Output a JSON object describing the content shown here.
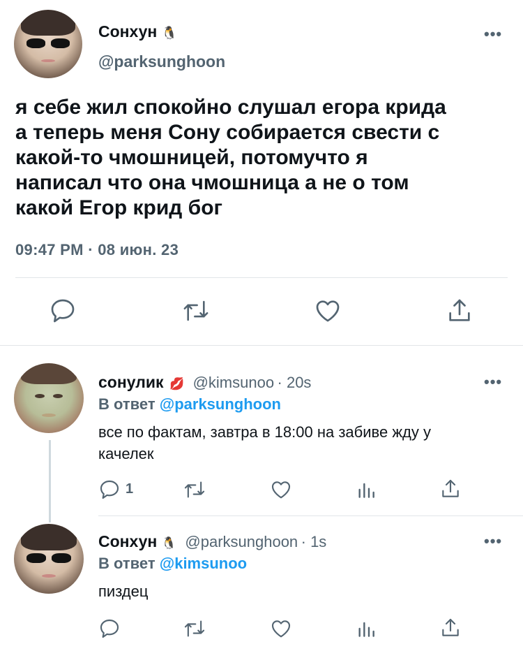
{
  "main_tweet": {
    "display_name": "Сонхун",
    "name_emoji": "🐧",
    "handle": "@parksunghoon",
    "text_lines": [
      "я себе жил спокойно слушал егора крида",
      "а теперь меня Сону собирается свести с",
      "какой-то чмошницей, потомучто я",
      "написал что она чмошница а не о том",
      "какой Егор крид бог"
    ],
    "timestamp": "09:47 PM · 08 июн. 23",
    "more": "•••",
    "actions": [
      "reply-icon",
      "retweet-icon",
      "like-icon",
      "share-icon"
    ]
  },
  "reply1": {
    "display_name": "сонулик",
    "name_emoji": "💋",
    "handle": "@kimsunoo",
    "time": "· 20s",
    "reply_to_prefix": "В ответ",
    "reply_to_mention": "@parksunghoon",
    "text_lines": [
      "все по фактам, завтра в 18:00 на забиве жду у",
      "качелек"
    ],
    "reply_count": "1",
    "more": "•••"
  },
  "reply2": {
    "display_name": "Сонхун",
    "name_emoji": "🐧",
    "handle": "@parksunghoon",
    "time": "· 1s",
    "reply_to_prefix": "В ответ",
    "reply_to_mention": "@kimsunoo",
    "text_lines": [
      "пиздец"
    ],
    "more": "•••"
  },
  "colors": {
    "text": "#0f1419",
    "muted": "#536471",
    "link": "#1d9bf0",
    "divider": "#e1e5e8"
  }
}
